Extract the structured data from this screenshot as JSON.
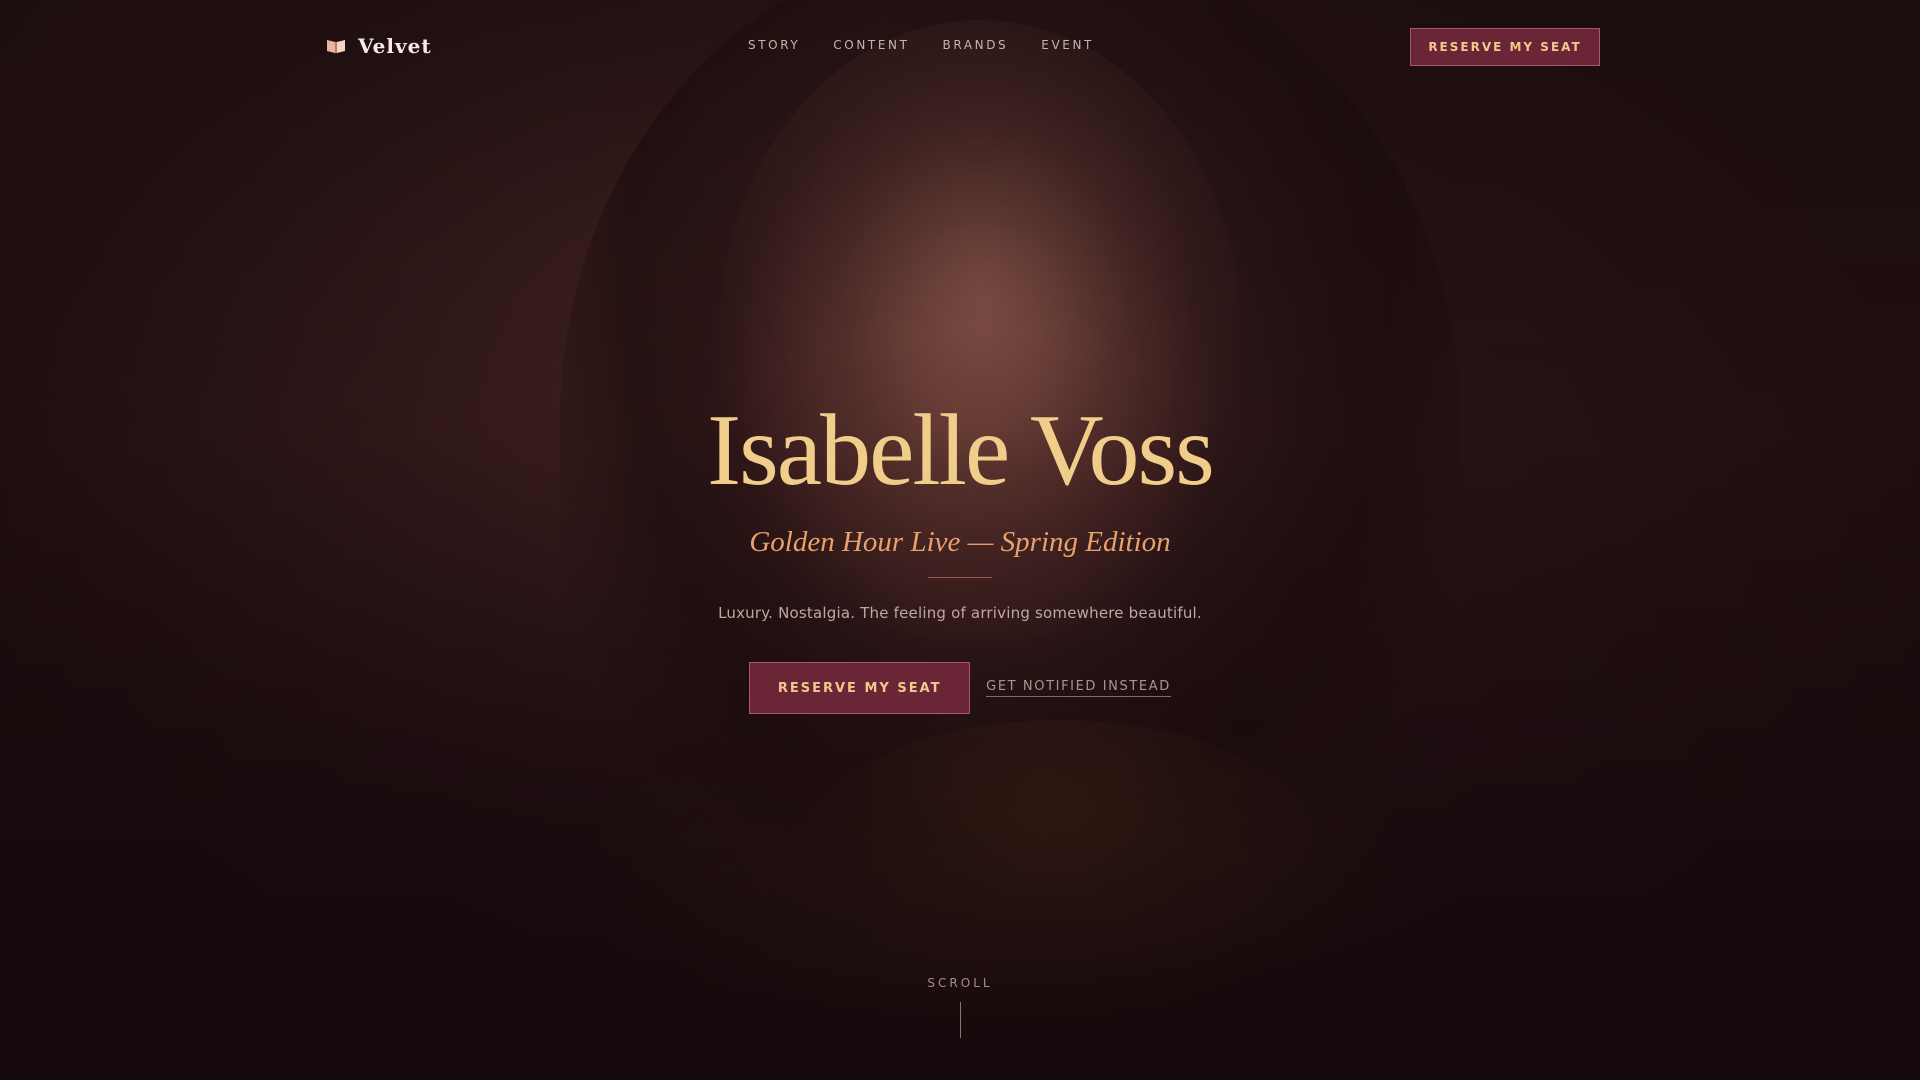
{
  "brand": {
    "name": "Velvet",
    "icon": "open-book-icon"
  },
  "nav": {
    "links": [
      "STORY",
      "CONTENT",
      "BRANDS",
      "EVENT"
    ],
    "cta_label": "RESERVE MY SEAT"
  },
  "hero": {
    "title": "Isabelle Voss",
    "subtitle": "Golden Hour Live — Spring Edition",
    "tagline": "Luxury. Nostalgia. The feeling of arriving somewhere beautiful.",
    "primary_cta": "RESERVE MY SEAT",
    "secondary_cta": "GET NOTIFIED INSTEAD"
  },
  "scroll": {
    "label": "SCROLL"
  },
  "colors": {
    "background": "#1c0f12",
    "accent_button": "#6a2537",
    "title_gold": "#f0cd8a",
    "subtitle_orange": "#e9a16b"
  }
}
